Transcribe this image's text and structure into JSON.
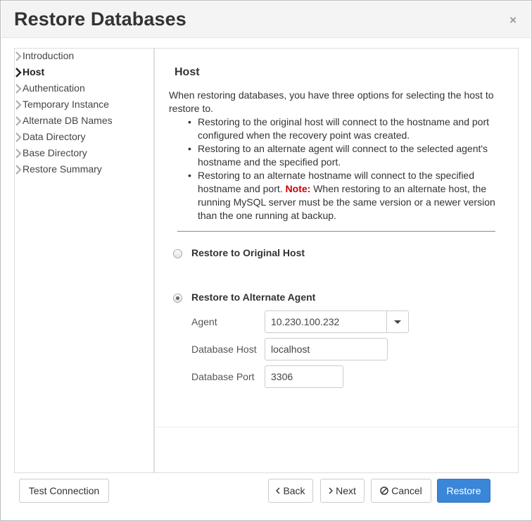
{
  "dialog": {
    "title": "Restore Databases",
    "close_symbol": "×"
  },
  "sidebar": {
    "items": [
      {
        "label": "Introduction",
        "active": false
      },
      {
        "label": "Host",
        "active": true
      },
      {
        "label": "Authentication",
        "active": false
      },
      {
        "label": "Temporary Instance",
        "active": false
      },
      {
        "label": "Alternate DB Names",
        "active": false
      },
      {
        "label": "Data Directory",
        "active": false
      },
      {
        "label": "Base Directory",
        "active": false
      },
      {
        "label": "Restore Summary",
        "active": false
      }
    ]
  },
  "main": {
    "section_title": "Host",
    "intro": "When restoring databases, you have three options for selecting the host to restore to.",
    "bullets": [
      "Restoring to the original host will connect to the hostname and port configured when the recovery point was created.",
      "Restoring to an alternate agent will connect to the selected agent's hostname and the specified port."
    ],
    "bullet3_pre": "Restoring to an alternate hostname will connect to the specified hostname and port.",
    "note_label": "Note:",
    "bullet3_post": "When restoring to an alternate host, the running MySQL server must be the same version or a newer version than the one running at backup.",
    "options": {
      "original_host": {
        "label": "Restore to Original Host",
        "selected": false
      },
      "alternate_agent": {
        "label": "Restore to Alternate Agent",
        "selected": true
      }
    },
    "form": {
      "agent_label": "Agent",
      "agent_value": "10.230.100.232",
      "db_host_label": "Database Host",
      "db_host_value": "localhost",
      "db_port_label": "Database Port",
      "db_port_value": "3306"
    }
  },
  "footer": {
    "test_connection": "Test Connection",
    "back": "Back",
    "next": "Next",
    "cancel": "Cancel",
    "restore": "Restore"
  },
  "colors": {
    "primary": "#3a86d8",
    "note": "#cc0000"
  }
}
